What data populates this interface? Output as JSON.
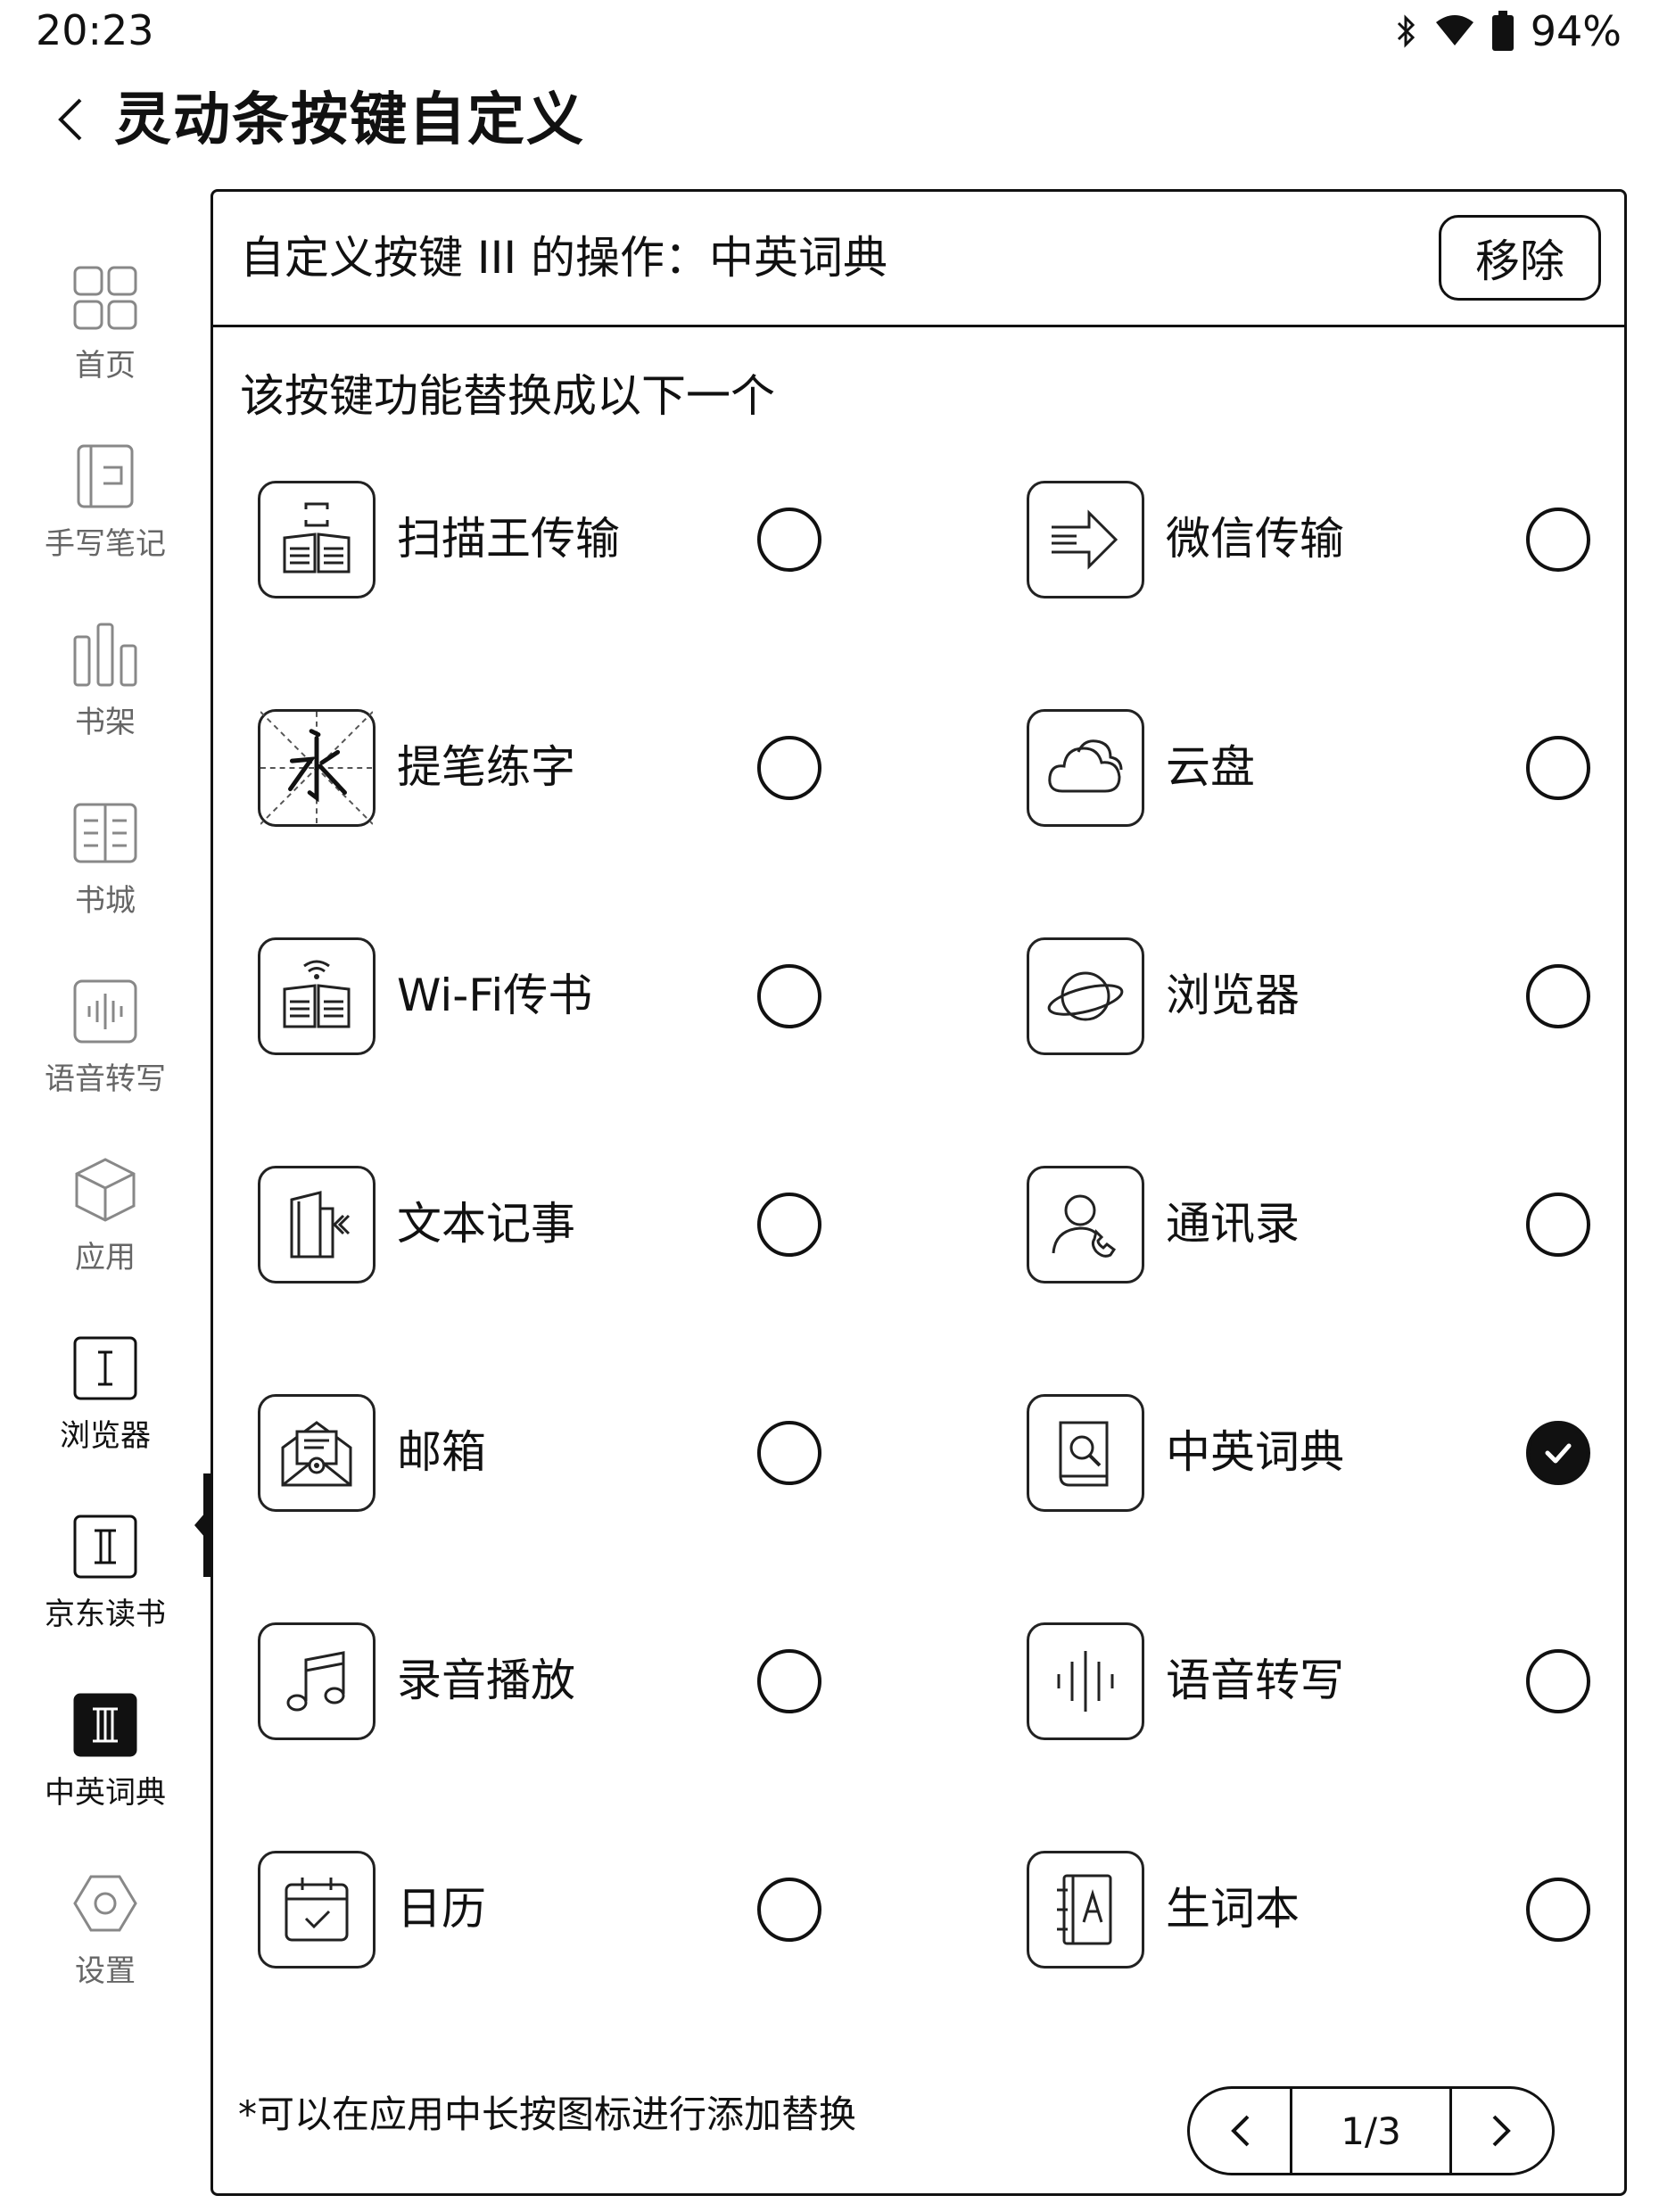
{
  "status": {
    "time": "20:23",
    "battery": "94%"
  },
  "header": {
    "title": "灵动条按键自定义"
  },
  "sidebar": {
    "items": [
      {
        "label": "首页",
        "icon": "grid-icon"
      },
      {
        "label": "手写笔记",
        "icon": "notebook-icon"
      },
      {
        "label": "书架",
        "icon": "bookshelf-icon"
      },
      {
        "label": "书城",
        "icon": "bookstore-icon"
      },
      {
        "label": "语音转写",
        "icon": "voice-wave-icon"
      },
      {
        "label": "应用",
        "icon": "cube-icon"
      },
      {
        "label": "浏览器",
        "icon": "roman-one-icon"
      },
      {
        "label": "京东读书",
        "icon": "roman-two-icon"
      },
      {
        "label": "中英词典",
        "icon": "roman-three-icon",
        "active": true
      },
      {
        "label": "设置",
        "icon": "hexagon-settings-icon"
      }
    ]
  },
  "panel": {
    "title": "自定义按键 III 的操作：中英词典",
    "remove_label": "移除",
    "subtitle": "该按键功能替换成以下一个",
    "hint": "*可以在应用中长按图标进行添加替换",
    "pager": {
      "page": "1/3"
    }
  },
  "options": [
    {
      "label": "扫描王传输",
      "icon": "scan-transfer-icon",
      "selected": false
    },
    {
      "label": "微信传输",
      "icon": "arrow-transfer-icon",
      "selected": false
    },
    {
      "label": "提笔练字",
      "icon": "calligraphy-icon",
      "selected": false
    },
    {
      "label": "云盘",
      "icon": "cloud-icon",
      "selected": false
    },
    {
      "label": "Wi-Fi传书",
      "icon": "wifi-books-icon",
      "selected": false
    },
    {
      "label": "浏览器",
      "icon": "planet-icon",
      "selected": false
    },
    {
      "label": "文本记事",
      "icon": "text-note-icon",
      "selected": false
    },
    {
      "label": "通讯录",
      "icon": "contacts-icon",
      "selected": false
    },
    {
      "label": "邮箱",
      "icon": "mail-icon",
      "selected": false
    },
    {
      "label": "中英词典",
      "icon": "dictionary-icon",
      "selected": true
    },
    {
      "label": "录音播放",
      "icon": "music-note-icon",
      "selected": false
    },
    {
      "label": "语音转写",
      "icon": "voice-wave-icon",
      "selected": false
    },
    {
      "label": "日历",
      "icon": "calendar-icon",
      "selected": false
    },
    {
      "label": "生词本",
      "icon": "vocab-book-icon",
      "selected": false
    }
  ]
}
